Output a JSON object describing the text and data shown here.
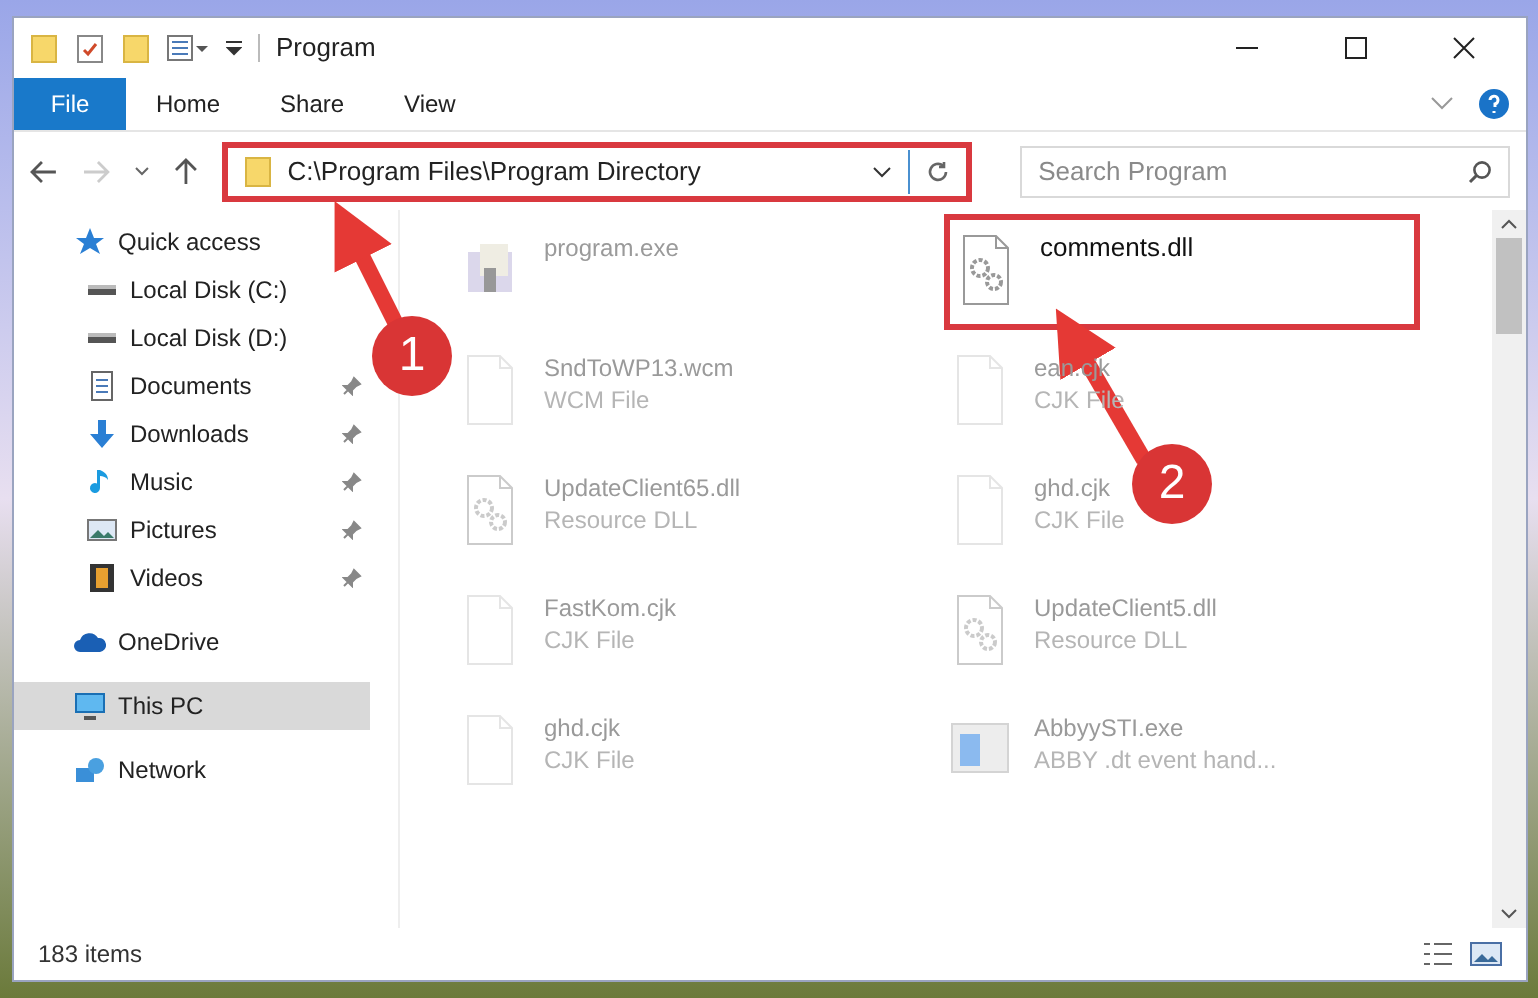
{
  "window": {
    "title": "Program"
  },
  "ribbon_tabs": [
    {
      "label": "File",
      "kind": "file"
    },
    {
      "label": "Home",
      "kind": "tab"
    },
    {
      "label": "Share",
      "kind": "tab"
    },
    {
      "label": "View",
      "kind": "tab"
    }
  ],
  "address_bar": {
    "path": "C:\\Program Files\\Program Directory",
    "highlighted": true
  },
  "search": {
    "placeholder": "Search Program"
  },
  "sidebar": {
    "items": [
      {
        "label": "Quick access",
        "kind": "group",
        "pinned": false,
        "selected": false
      },
      {
        "label": "Local Disk (C:)",
        "kind": "item",
        "pinned": false,
        "selected": false
      },
      {
        "label": "Local Disk (D:)",
        "kind": "item",
        "pinned": false,
        "selected": false
      },
      {
        "label": "Documents",
        "kind": "item",
        "pinned": true,
        "selected": false
      },
      {
        "label": "Downloads",
        "kind": "item",
        "pinned": true,
        "selected": false
      },
      {
        "label": "Music",
        "kind": "item",
        "pinned": true,
        "selected": false
      },
      {
        "label": "Pictures",
        "kind": "item",
        "pinned": true,
        "selected": false
      },
      {
        "label": "Videos",
        "kind": "item",
        "pinned": true,
        "selected": false
      },
      {
        "label": "OneDrive",
        "kind": "group",
        "pinned": false,
        "selected": false
      },
      {
        "label": "This PC",
        "kind": "group",
        "pinned": false,
        "selected": true
      },
      {
        "label": "Network",
        "kind": "group",
        "pinned": false,
        "selected": false
      }
    ]
  },
  "files": [
    {
      "name": "program.exe",
      "kind": "exe",
      "faded": true,
      "highlighted": false
    },
    {
      "name": "comments.dll",
      "kind": "dll",
      "faded": false,
      "highlighted": true
    },
    {
      "name": "SndToWP13.wcm",
      "type": "WCM File",
      "kind": "file",
      "faded": true,
      "highlighted": false
    },
    {
      "name": "ean.cjk",
      "type": "CJK File",
      "kind": "file",
      "faded": true,
      "highlighted": false
    },
    {
      "name": "UpdateClient65.dll",
      "type": "Resource DLL",
      "kind": "dll",
      "faded": true,
      "highlighted": false
    },
    {
      "name": "ghd.cjk",
      "type": "CJK File",
      "kind": "file",
      "faded": true,
      "highlighted": false
    },
    {
      "name": "FastKom.cjk",
      "type": "CJK File",
      "kind": "file",
      "faded": true,
      "highlighted": false
    },
    {
      "name": "UpdateClient5.dll",
      "type": "Resource DLL",
      "kind": "dll",
      "faded": true,
      "highlighted": false
    },
    {
      "name": "ghd.cjk",
      "type": "CJK File",
      "kind": "file",
      "faded": true,
      "highlighted": false
    },
    {
      "name": "AbbyySTI.exe",
      "type": "ABBY .dt event hand...",
      "kind": "app",
      "faded": true,
      "highlighted": false
    }
  ],
  "status_bar": {
    "count": "183 items"
  },
  "annotations": [
    {
      "label": "1"
    },
    {
      "label": "2"
    }
  ]
}
